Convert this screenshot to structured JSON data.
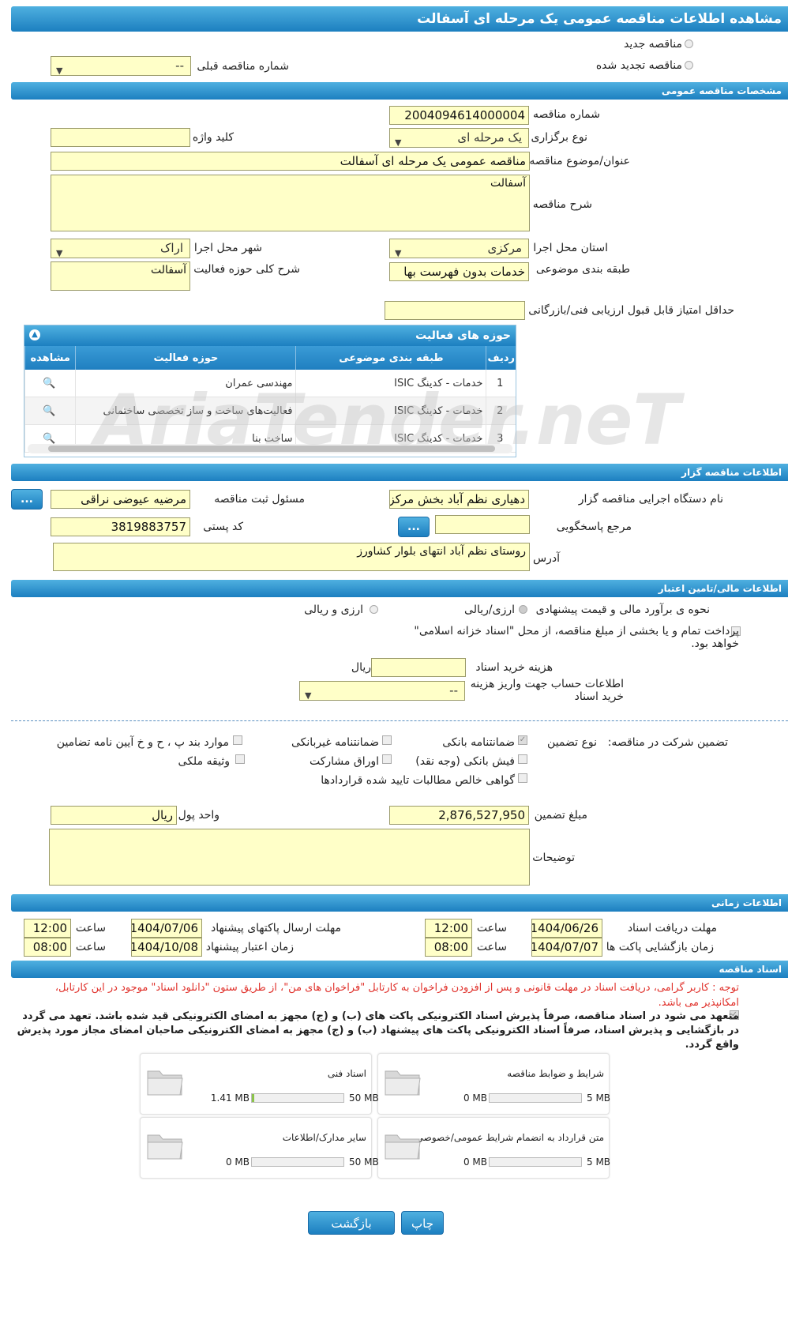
{
  "page_title": "مشاهده اطلاعات مناقصه عمومی یک مرحله ای آسفالت",
  "top": {
    "new_label": "مناقصه جدید",
    "renewed_label": "مناقصه تجدید شده",
    "prev_number_label": "شماره مناقصه قبلی",
    "prev_number_value": "--"
  },
  "general": {
    "header": "مشخصات مناقصه عمومی",
    "number_label": "شماره مناقصه",
    "number_value": "2004094614000004",
    "type_label": "نوع برگزاری",
    "type_value": "یک مرحله ای",
    "keyword_label": "کلید واژه",
    "keyword_value": "",
    "subject_label": "عنوان/موضوع مناقصه",
    "subject_value": "مناقصه عمومی یک مرحله ای آسفالت",
    "desc_label": "شرح مناقصه",
    "desc_value": "آسفالت",
    "province_label": "استان محل اجرا",
    "province_value": "مرکزی",
    "city_label": "شهر محل اجرا",
    "city_value": "اراک",
    "category_label": "طبقه بندی موضوعی",
    "category_value": "خدمات بدون فهرست بها",
    "activity_desc_label": "شرح کلی حوزه فعالیت",
    "activity_desc_value": "آسفالت",
    "min_score_label": "حداقل امتیاز قابل قبول ارزیابی فنی/بازرگانی",
    "min_score_value": ""
  },
  "activity_grid": {
    "title": "حوزه های فعالیت",
    "columns": [
      "ردیف",
      "طبقه بندی موضوعی",
      "حوزه فعالیت",
      "مشاهده"
    ],
    "rows": [
      {
        "idx": "1",
        "category": "خدمات - کدینگ ISIC",
        "field": "مهندسی عمران"
      },
      {
        "idx": "2",
        "category": "خدمات - کدینگ ISIC",
        "field": "فعالیت‌های ساخت و ساز تخصصی ساختمانی"
      },
      {
        "idx": "3",
        "category": "خدمات - کدینگ ISIC",
        "field": "ساخت بنا"
      }
    ]
  },
  "organizer": {
    "header": "اطلاعات مناقصه گزار",
    "org_label": "نام دستگاه اجرایی مناقصه گزار",
    "org_value": "دهیاری نظم آباد بخش مرکزی",
    "responsible_label": "مسئول ثبت مناقصه",
    "responsible_value": "مرضیه عیوضی نراقی",
    "ref_label": "مرجع پاسخگویی",
    "ref_value": "",
    "postal_label": "کد پستی",
    "postal_value": "3819883757",
    "address_label": "آدرس",
    "address_value": "روستای نظم آباد انتهای بلوار کشاورز",
    "dots": "..."
  },
  "financial": {
    "header": "اطلاعات مالی/تامین اعتبار",
    "estimate_label": "نحوه ی برآورد مالی و قیمت پیشنهادی",
    "opt_rial": "ارزی/ریالی",
    "opt_both": "ارزی و ریالی",
    "treasury_label": "پرداخت تمام و یا بخشی از مبلغ مناقصه، از محل \"اسناد خزانه اسلامی\" خواهد بود.",
    "doc_cost_label": "هزینه خرید اسناد",
    "doc_cost_value": "",
    "doc_cost_unit": "ریال",
    "account_label": "اطلاعات حساب جهت واریز هزینه خرید اسناد",
    "account_value": "--"
  },
  "guarantee": {
    "section_label": "تضمین شرکت در مناقصه:",
    "type_label": "نوع تضمین",
    "bank_guarantee": "ضمانتنامه بانکی",
    "nonbank_guarantee": "ضمانتنامه غیربانکی",
    "items_bph": "موارد بند پ ، ح و خ آیین نامه تضامین",
    "cash_receipt": "فیش بانکی (وجه نقد)",
    "bonds": "اوراق مشارکت",
    "property": "وثیقه ملکی",
    "certificate": "گواهی خالص مطالبات تایید شده قراردادها",
    "amount_label": "مبلغ تضمین",
    "amount_value": "2,876,527,950",
    "currency_label": "واحد پول",
    "currency_value": "ریال",
    "notes_label": "توضیحات",
    "notes_value": ""
  },
  "timing": {
    "header": "اطلاعات زمانی",
    "doc_deadline_label": "مهلت دریافت اسناد",
    "doc_deadline_date": "1404/06/26",
    "doc_deadline_time": "12:00",
    "submit_deadline_label": "مهلت ارسال پاکتهای پیشنهاد",
    "submit_deadline_date": "1404/07/06",
    "submit_deadline_time": "12:00",
    "opening_label": "زمان بازگشایی پاکت ها",
    "opening_date": "1404/07/07",
    "opening_time": "08:00",
    "validity_label": "زمان اعتبار پیشنهاد",
    "validity_date": "1404/10/08",
    "validity_time": "08:00",
    "time_label": "ساعت"
  },
  "documents": {
    "header": "اسناد مناقصه",
    "notice": "توجه : کاربر گرامی، دریافت اسناد در مهلت قانونی و پس از افزودن فراخوان به کارتابل \"فراخوان های من\"، از طریق ستون \"دانلود اسناد\" موجود در این کارتابل، امکانپذیر می باشد.",
    "commitment": "متعهد می شود در اسناد مناقصه، صرفاً پذیرش اسناد الکترونیکی پاکت های (ب) و (ج) مجهز به امضای الکترونیکی قید شده باشد. تعهد می گردد در بازگشایی و پذیرش اسناد، صرفاً اسناد الکترونیکی پاکت های پیشنهاد (ب) و (ج) مجهز به امضای الکترونیکی صاحبان امضای مجاز مورد پذیرش واقع گردد.",
    "cards": [
      {
        "title": "شرایط و ضوابط مناقصه",
        "current": "0 MB",
        "max": "5 MB",
        "fill": 0.0
      },
      {
        "title": "اسناد فنی",
        "current": "1.41 MB",
        "max": "50 MB",
        "fill": 0.03
      },
      {
        "title": "متن قرارداد به انضمام شرایط عمومی/خصوصی",
        "current": "0 MB",
        "max": "5 MB",
        "fill": 0.0
      },
      {
        "title": "سایر مدارک/اطلاعات",
        "current": "0 MB",
        "max": "50 MB",
        "fill": 0.0
      }
    ]
  },
  "footer": {
    "print_label": "چاپ",
    "back_label": "بازگشت"
  },
  "watermark": "AriaTender.neT",
  "colors": {
    "header": "#1c7fc0",
    "field": "#ffffc8",
    "notice": "#e0302a"
  }
}
